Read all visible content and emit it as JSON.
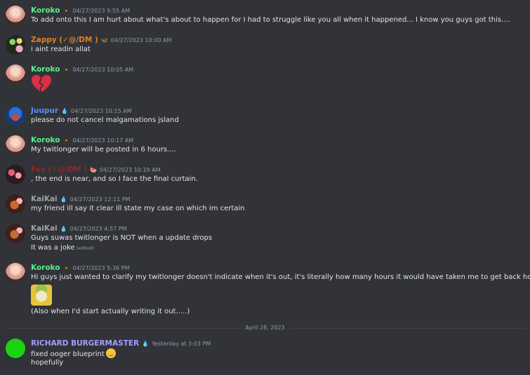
{
  "colors": {
    "background": "#313338",
    "koroko": "#57f287",
    "zappy": "#e67e22",
    "juupur": "#5b8cff",
    "fox": "#8b2b2b",
    "kaikai": "#9ea2a6",
    "richard": "#a59cff"
  },
  "messages": [
    {
      "author": "Koroko",
      "badge": "🔸",
      "time": "04/27/2023 9:55 AM",
      "lines": [
        "To add onto this I am hurt about what's about to happen for I had to struggle like you all when it happened... I know you guys got this...."
      ]
    },
    {
      "author": "Zappy (✓@/DM )",
      "badge": "🦋",
      "time": "04/27/2023 10:00 AM",
      "lines": [
        "i aint readin allat"
      ]
    },
    {
      "author": "Koroko",
      "badge": "🔸",
      "time": "04/27/2023 10:05 AM",
      "emoji": "broken-heart"
    },
    {
      "author": "Juupur",
      "badge": "💧",
      "time": "04/27/2023 10:15 AM",
      "lines": [
        "please do not cancel malgamations jsland"
      ]
    },
    {
      "author": "Koroko",
      "badge": "🔸",
      "time": "04/27/2023 10:17 AM",
      "lines": [
        "My twitlonger will be posted in 6 hours...."
      ]
    },
    {
      "author": "Fox (✓@/DM )",
      "badge": "🍉",
      "time": "04/27/2023 10:19 AM",
      "lines": [
        ", the end is near, and so I face the final curtain."
      ]
    },
    {
      "author": "KaiKai",
      "badge": "💧",
      "time": "04/27/2023 12:11 PM",
      "lines": [
        "my friend ill say it clear ill state my case on which im certain"
      ]
    },
    {
      "author": "KaiKai",
      "badge": "💧",
      "time": "04/27/2023 4:57 PM",
      "lines": [
        "Guys suwas twitlonger is NOT when a update drops",
        "It was a joke"
      ],
      "edited": "(edited)"
    },
    {
      "author": "Koroko",
      "badge": "🔸",
      "time": "04/27/2023 5:36 PM",
      "lines": [
        "Hi guys just wanted to clarify my twitlonger doesn't indicate when it's out, it's literally how many hours it would have taken me to get back home....",
        "(Also when I'd start actually writing it out.....)"
      ]
    },
    {
      "author": "RICHARD BURGERMASTER",
      "badge": "💧",
      "time": "Yesterday at 3:03 PM",
      "lines": [
        "fixed ooger blueprint",
        "hopefully"
      ],
      "emoji": "smiling-face"
    }
  ],
  "divider": "April 28, 2023"
}
